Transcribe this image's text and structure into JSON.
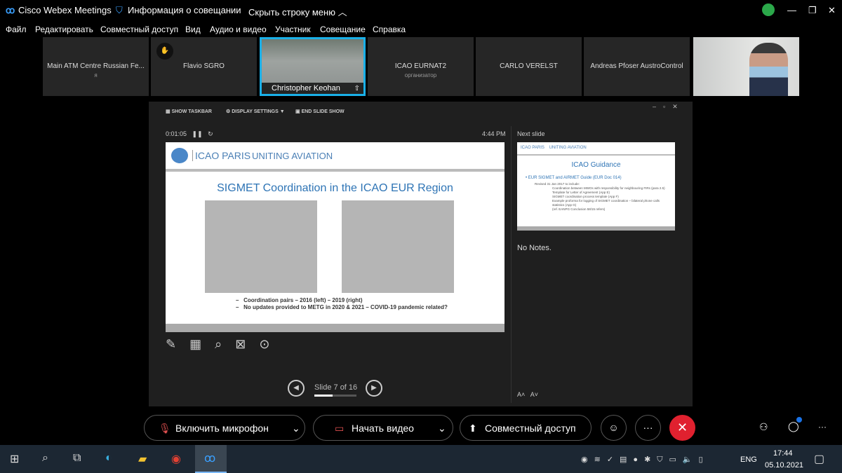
{
  "app": {
    "title": "Cisco Webex Meetings",
    "meeting_info": "Информация о совещании",
    "hide_menu": "Скрыть строку меню"
  },
  "menu": [
    "Файл",
    "Редактировать",
    "Совместный доступ",
    "Вид",
    "Аудио и видео",
    "Участник",
    "Совещание",
    "Справка"
  ],
  "participants": [
    {
      "name": "Main ATM Centre Russian Fe...",
      "sub": "я"
    },
    {
      "name": "Flavio SGRO",
      "sub": ""
    },
    {
      "name": "Christopher Keohan",
      "sub": ""
    },
    {
      "name": "ICAO EURNAT2",
      "sub": "организатор"
    },
    {
      "name": "CARLO VERELST",
      "sub": ""
    },
    {
      "name": "Andreas Pfoser AustroControl",
      "sub": ""
    }
  ],
  "presenter": {
    "show_taskbar": "SHOW TASKBAR",
    "display_settings": "DISPLAY SETTINGS ▼",
    "end_show": "END SLIDE SHOW",
    "timer": "0:01:05",
    "clock": "4:44 PM",
    "next_slide_label": "Next slide",
    "notes": "No Notes.",
    "slide_counter": "Slide 7 of 16",
    "progress": 0.4375
  },
  "slide": {
    "org": "ICAO  PARIS",
    "tagline": "UNITING AVIATION",
    "title": "SIGMET Coordination in the ICAO EUR Region",
    "bullets": [
      "Coordination pairs – 2016 (left) – 2019 (right)",
      "No updates provided to METG in 2020 & 2021 – COVID-19 pandemic related?"
    ]
  },
  "next_slide": {
    "org": "ICAO  PARIS",
    "tagline": "UNITING AVIATION",
    "title": "ICAO Guidance",
    "bullet": "EUR SIGMET and AIRMET Guide (EUR Doc 014)",
    "sub": "Revised 31 Jan 2017 to include:",
    "items": [
      "Coordination between MWOs with responsibility for neighbouring FIRs (para 2.5)",
      "Template for Letter of Agreement (App E)",
      "SIGMET coordination process template (App F)",
      "Example proforma for logging of SIGMET coordination – bilateral phone calls statistics (App G)"
    ],
    "ref": "(ref. EANPG Conclusion 58/15 refers)"
  },
  "controls": {
    "mic": "Включить микрофон",
    "video": "Начать видео",
    "share": "Совместный доступ"
  },
  "taskbar": {
    "lang": "ENG",
    "time": "17:44",
    "date": "05.10.2021"
  },
  "colors": {
    "accent": "#1ab0e8",
    "end": "#e0212f",
    "slide_blue": "#2e74b5"
  }
}
